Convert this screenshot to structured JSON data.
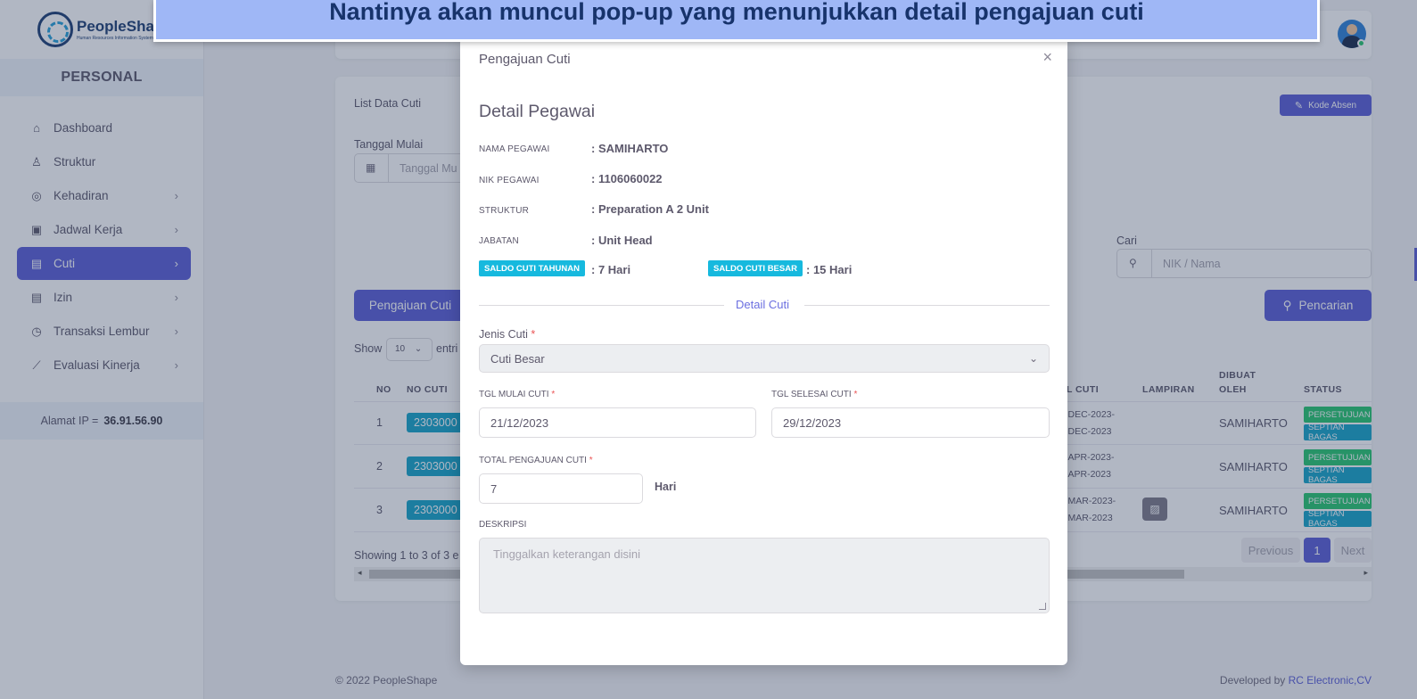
{
  "banner": {
    "text": "Nantinya akan muncul pop-up yang menunjukkan detail pengajuan cuti"
  },
  "app": {
    "logo_text": "PeopleShape",
    "logo_sub": "Human Resources Information System"
  },
  "sidebar": {
    "section_title": "PERSONAL",
    "items": [
      {
        "label": "Dashboard",
        "icon": "home-icon"
      },
      {
        "label": "Struktur",
        "icon": "sitemap-icon"
      },
      {
        "label": "Kehadiran",
        "icon": "fingerprint-icon"
      },
      {
        "label": "Jadwal Kerja",
        "icon": "briefcase-icon"
      },
      {
        "label": "Cuti",
        "icon": "calendar-icon"
      },
      {
        "label": "Izin",
        "icon": "calendar-icon"
      },
      {
        "label": "Transaksi Lembur",
        "icon": "clock-icon"
      },
      {
        "label": "Evaluasi Kinerja",
        "icon": "chart-icon"
      }
    ],
    "ip_label": "Alamat IP  =",
    "ip_value": "36.91.56.90"
  },
  "page": {
    "card_title": "List Data Cuti",
    "kode_absen_label": "Kode Absen",
    "tanggal_mulai_label": "Tanggal Mulai",
    "tanggal_mulai_placeholder": "Tanggal Mu",
    "cari_label": "Cari",
    "cari_placeholder": "NIK / Nama",
    "pengajuan_button": "Pengajuan Cuti",
    "pencarian_button": "Pencarian",
    "show_label": "Show",
    "show_value": "10",
    "entries_label": "entri",
    "table_headers": {
      "no": "NO",
      "no_cuti": "NO CUTI",
      "tgl_cuti": "L CUTI",
      "lampiran": "LAMPIRAN",
      "dibuat_oleh_1": "DIBUAT",
      "dibuat_oleh_2": "OLEH",
      "status": "STATUS"
    },
    "rows": [
      {
        "no": "1",
        "no_cuti": "2303000",
        "date1": "-DEC-2023-",
        "date2": "-DEC-2023",
        "by": "SAMIHARTO",
        "status1": "PERSETUJUAN",
        "status2": "SEPTIAN BAGAS"
      },
      {
        "no": "2",
        "no_cuti": "2303000",
        "date1": "-APR-2023-",
        "date2": "-APR-2023",
        "by": "SAMIHARTO",
        "status1": "PERSETUJUAN",
        "status2": "SEPTIAN BAGAS"
      },
      {
        "no": "3",
        "no_cuti": "2303000",
        "date1": "-MAR-2023-",
        "date2": "-MAR-2023",
        "by": "SAMIHARTO",
        "status1": "PERSETUJUAN",
        "status2": "SEPTIAN BAGAS"
      }
    ],
    "showing_text": "Showing 1 to 3 of 3 e",
    "pagination": {
      "previous": "Previous",
      "current": "1",
      "next": "Next"
    },
    "footer_left": "© 2022 PeopleShape",
    "footer_right_prefix": "Developed by ",
    "footer_right_link": "RC Electronic,CV"
  },
  "modal": {
    "title": "Pengajuan Cuti",
    "close": "×",
    "heading": "Detail Pegawai",
    "fields": [
      {
        "label": "NAMA PEGAWAI",
        "value": ": SAMIHARTO"
      },
      {
        "label": "NIK PEGAWAI",
        "value": ": 1106060022"
      },
      {
        "label": "STRUKTUR",
        "value": ": Preparation A 2 Unit"
      },
      {
        "label": "JABATAN",
        "value": ": Unit Head"
      }
    ],
    "saldo_tahunan_label": "SALDO CUTI TAHUNAN",
    "saldo_tahunan_value": ": 7 Hari",
    "saldo_besar_label": "SALDO CUTI BESAR",
    "saldo_besar_value": ": 15 Hari",
    "detail_cuti_label": "Detail Cuti",
    "jenis_cuti_label": "Jenis Cuti",
    "jenis_cuti_value": "Cuti Besar",
    "tgl_mulai_label": "TGL MULAI CUTI",
    "tgl_mulai_value": "21/12/2023",
    "tgl_selesai_label": "TGL SELESAI CUTI",
    "tgl_selesai_value": "29/12/2023",
    "total_label": "TOTAL PENGAJUAN CUTI",
    "total_value": "7",
    "total_unit": "Hari",
    "deskripsi_label": "DESKRIPSI",
    "deskripsi_placeholder": "Tinggalkan keterangan disini",
    "required_mark": "*"
  },
  "colors": {
    "primary": "#5b5fd6",
    "info": "#16a5c9",
    "success": "#28c76f",
    "banner": "#9fb7f6"
  }
}
